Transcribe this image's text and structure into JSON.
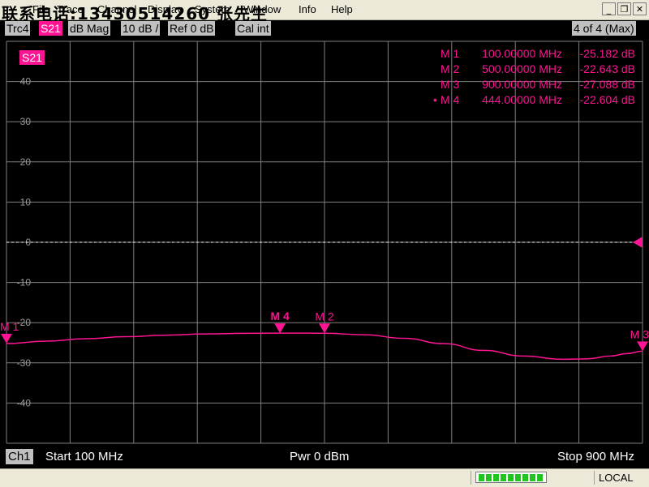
{
  "watermark": "联系电话:13430514260 张先生",
  "menu": {
    "items": [
      "File",
      "Trace",
      "Channel",
      "Display",
      "System",
      "Window",
      "Info",
      "Help"
    ]
  },
  "window_buttons": {
    "minimize": "_",
    "restore": "❐",
    "close": "✕"
  },
  "trace_header": {
    "trace": "Trc4",
    "param": "S21",
    "format": "dB Mag",
    "scale": "10 dB /",
    "ref": "Ref 0 dB",
    "cal": "Cal int",
    "window_count": "4 of 4 (Max)"
  },
  "colors": {
    "trace": "#ff1493",
    "grid": "#7f7f7f",
    "background": "#000000"
  },
  "chart_data": {
    "type": "line",
    "param_label": "S21",
    "x_unit": "MHz",
    "xlim": [
      100,
      900
    ],
    "ylim": [
      -50,
      50
    ],
    "y_ticks": [
      40,
      30,
      20,
      10,
      0,
      -10,
      -20,
      -30,
      -40
    ],
    "y_tick_labels": [
      "40",
      "30",
      "20",
      "10",
      "0",
      "-10",
      "-20",
      "-30",
      "-40"
    ],
    "grid": true,
    "reference_level": 0,
    "series": [
      {
        "x": [
          100,
          150,
          200,
          250,
          300,
          350,
          400,
          444,
          480,
          500,
          550,
          600,
          650,
          700,
          750,
          800,
          830,
          860,
          880,
          900
        ],
        "y": [
          -25.18,
          -24.6,
          -24.0,
          -23.5,
          -23.1,
          -22.8,
          -22.65,
          -22.6,
          -22.6,
          -22.64,
          -23.0,
          -23.9,
          -25.2,
          -26.9,
          -28.3,
          -29.1,
          -29.0,
          -28.3,
          -27.7,
          -27.09
        ]
      }
    ],
    "markers": [
      {
        "label": "M 1",
        "x": 100.0,
        "y": -25.182,
        "freq_text": "100.00000 MHz",
        "value_text": "-25.182 dB",
        "active": false
      },
      {
        "label": "M 2",
        "x": 500.0,
        "y": -22.643,
        "freq_text": "500.00000 MHz",
        "value_text": "-22.643 dB",
        "active": false
      },
      {
        "label": "M 3",
        "x": 900.0,
        "y": -27.088,
        "freq_text": "900.00000 MHz",
        "value_text": "-27.088 dB",
        "active": false
      },
      {
        "label": "M 4",
        "x": 444.0,
        "y": -22.604,
        "freq_text": "444.00000 MHz",
        "value_text": "-22.604 dB",
        "active": true
      }
    ]
  },
  "footer": {
    "channel": "Ch1",
    "start": "Start  100 MHz",
    "power": "Pwr  0 dBm",
    "stop": "Stop  900 MHz"
  },
  "status": {
    "progress_segments": 9,
    "mode": "LOCAL"
  }
}
